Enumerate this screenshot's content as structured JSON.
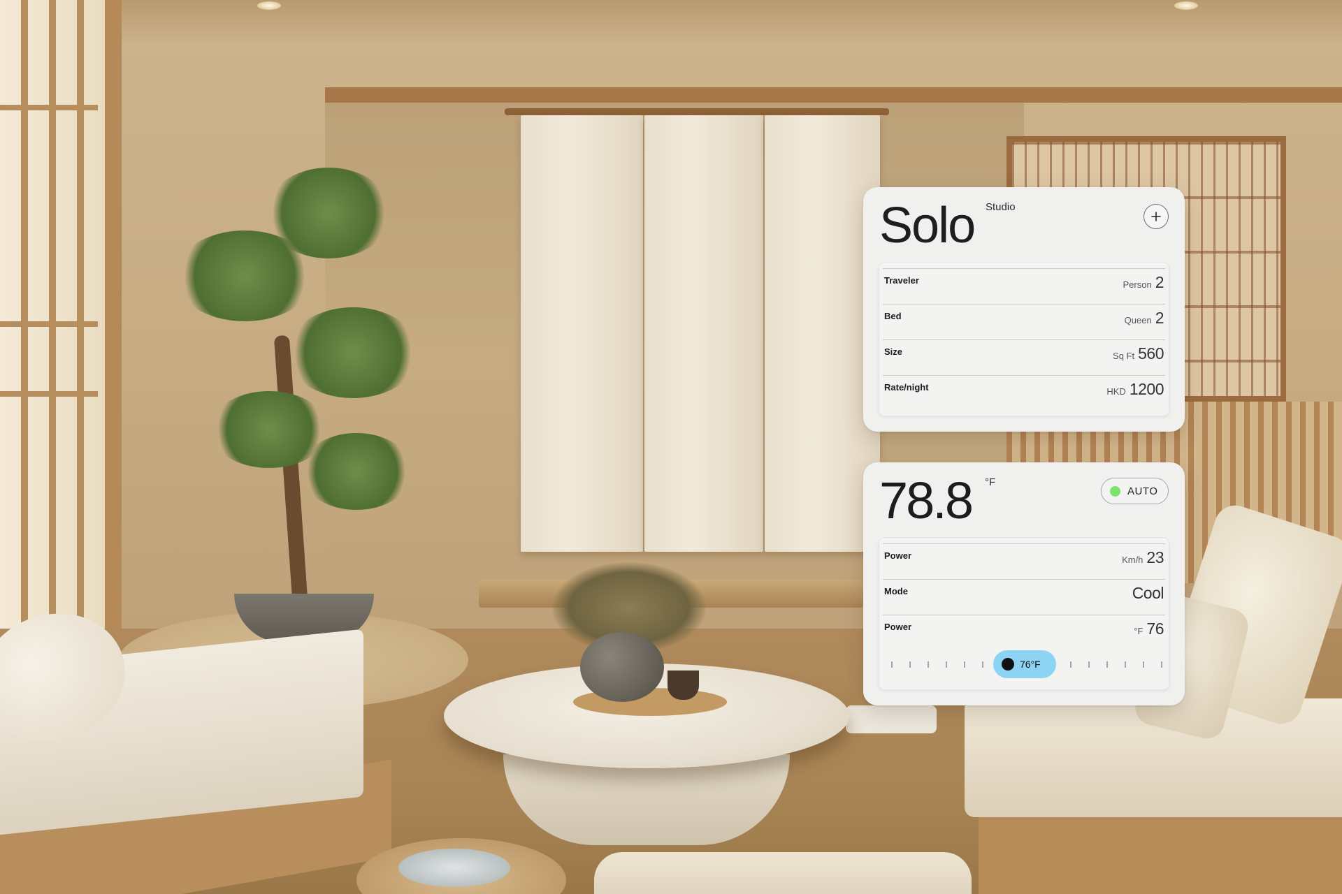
{
  "room_card": {
    "title": "Solo",
    "subtitle": "Studio",
    "add_icon": "plus-icon",
    "rows": [
      {
        "label": "Traveler",
        "unit": "Person",
        "value": "2"
      },
      {
        "label": "Bed",
        "unit": "Queen",
        "value": "2"
      },
      {
        "label": "Size",
        "unit": "Sq Ft",
        "value": "560"
      },
      {
        "label": "Rate/night",
        "unit": "HKD",
        "value": "1200"
      }
    ]
  },
  "climate_card": {
    "temperature": "78.8",
    "temperature_unit": "°F",
    "mode_button": {
      "label": "AUTO",
      "indicator_color": "#7ee36a"
    },
    "rows": [
      {
        "label": "Power",
        "unit": "Km/h",
        "value": "23"
      },
      {
        "label": "Mode",
        "unit": "",
        "value": "Cool"
      },
      {
        "label": "Power",
        "unit": "°F",
        "value": "76"
      }
    ],
    "slider": {
      "value_label": "76°F",
      "thumb_color": "#8dd3f3"
    }
  }
}
